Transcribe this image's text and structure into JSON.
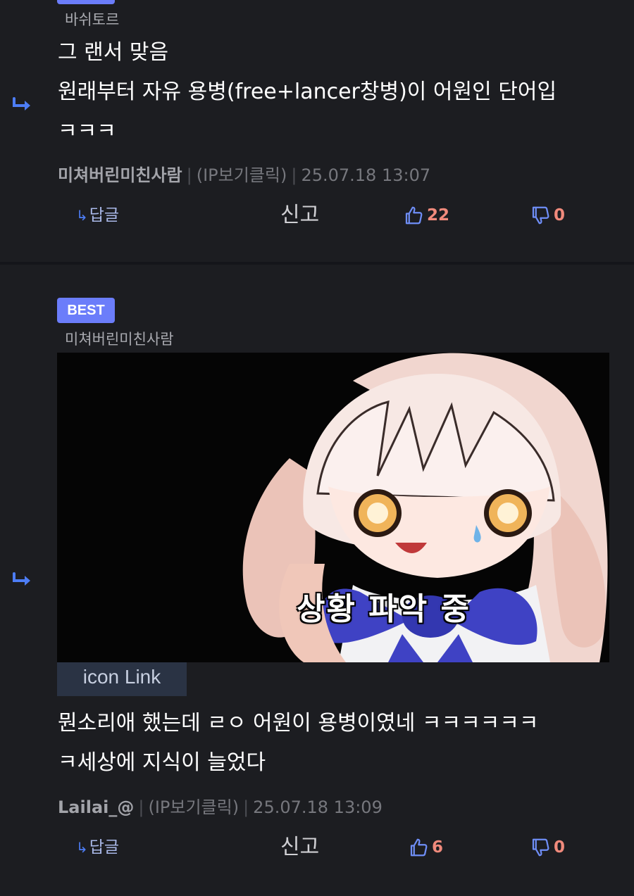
{
  "comments": [
    {
      "reply_to": "바쉬토르",
      "body": [
        "그 랜서 맞음",
        "원래부터 자유 용병(free+lancer창병)이 어원인 단어입",
        "ㅋㅋㅋ"
      ],
      "author": "미쳐버린미친사람",
      "ip": "(IP보기클릭)",
      "timestamp": "25.07.18 13:07",
      "reply_label": "답글",
      "report_label": "신고",
      "likes": "22",
      "dislikes": "0"
    },
    {
      "badge": "BEST",
      "reply_to": "미쳐버린미친사람",
      "image_caption": "상황 파악 중",
      "link_label": "icon Link",
      "body": [
        "뭔소리애 했는데 ㄹㅇ 어원이 용병이였네 ㅋㅋㅋㅋㅋㅋ",
        "ㅋ세상에 지식이 늘었다"
      ],
      "author": "Lailai_@",
      "ip": "(IP보기클릭)",
      "timestamp": "25.07.18 13:09",
      "reply_label": "답글",
      "report_label": "신고",
      "likes": "6",
      "dislikes": "0"
    }
  ],
  "colors": {
    "background": "#1c1d21",
    "badge": "#6b7dfa",
    "reply_arrow": "#4d7df5",
    "vote_count": "#f08a7c",
    "like_icon": "#6f8ef7"
  },
  "icons": {
    "reply_arrow": "reply-arrow-icon",
    "like": "thumbs-up-icon",
    "dislike": "thumbs-down-icon"
  }
}
